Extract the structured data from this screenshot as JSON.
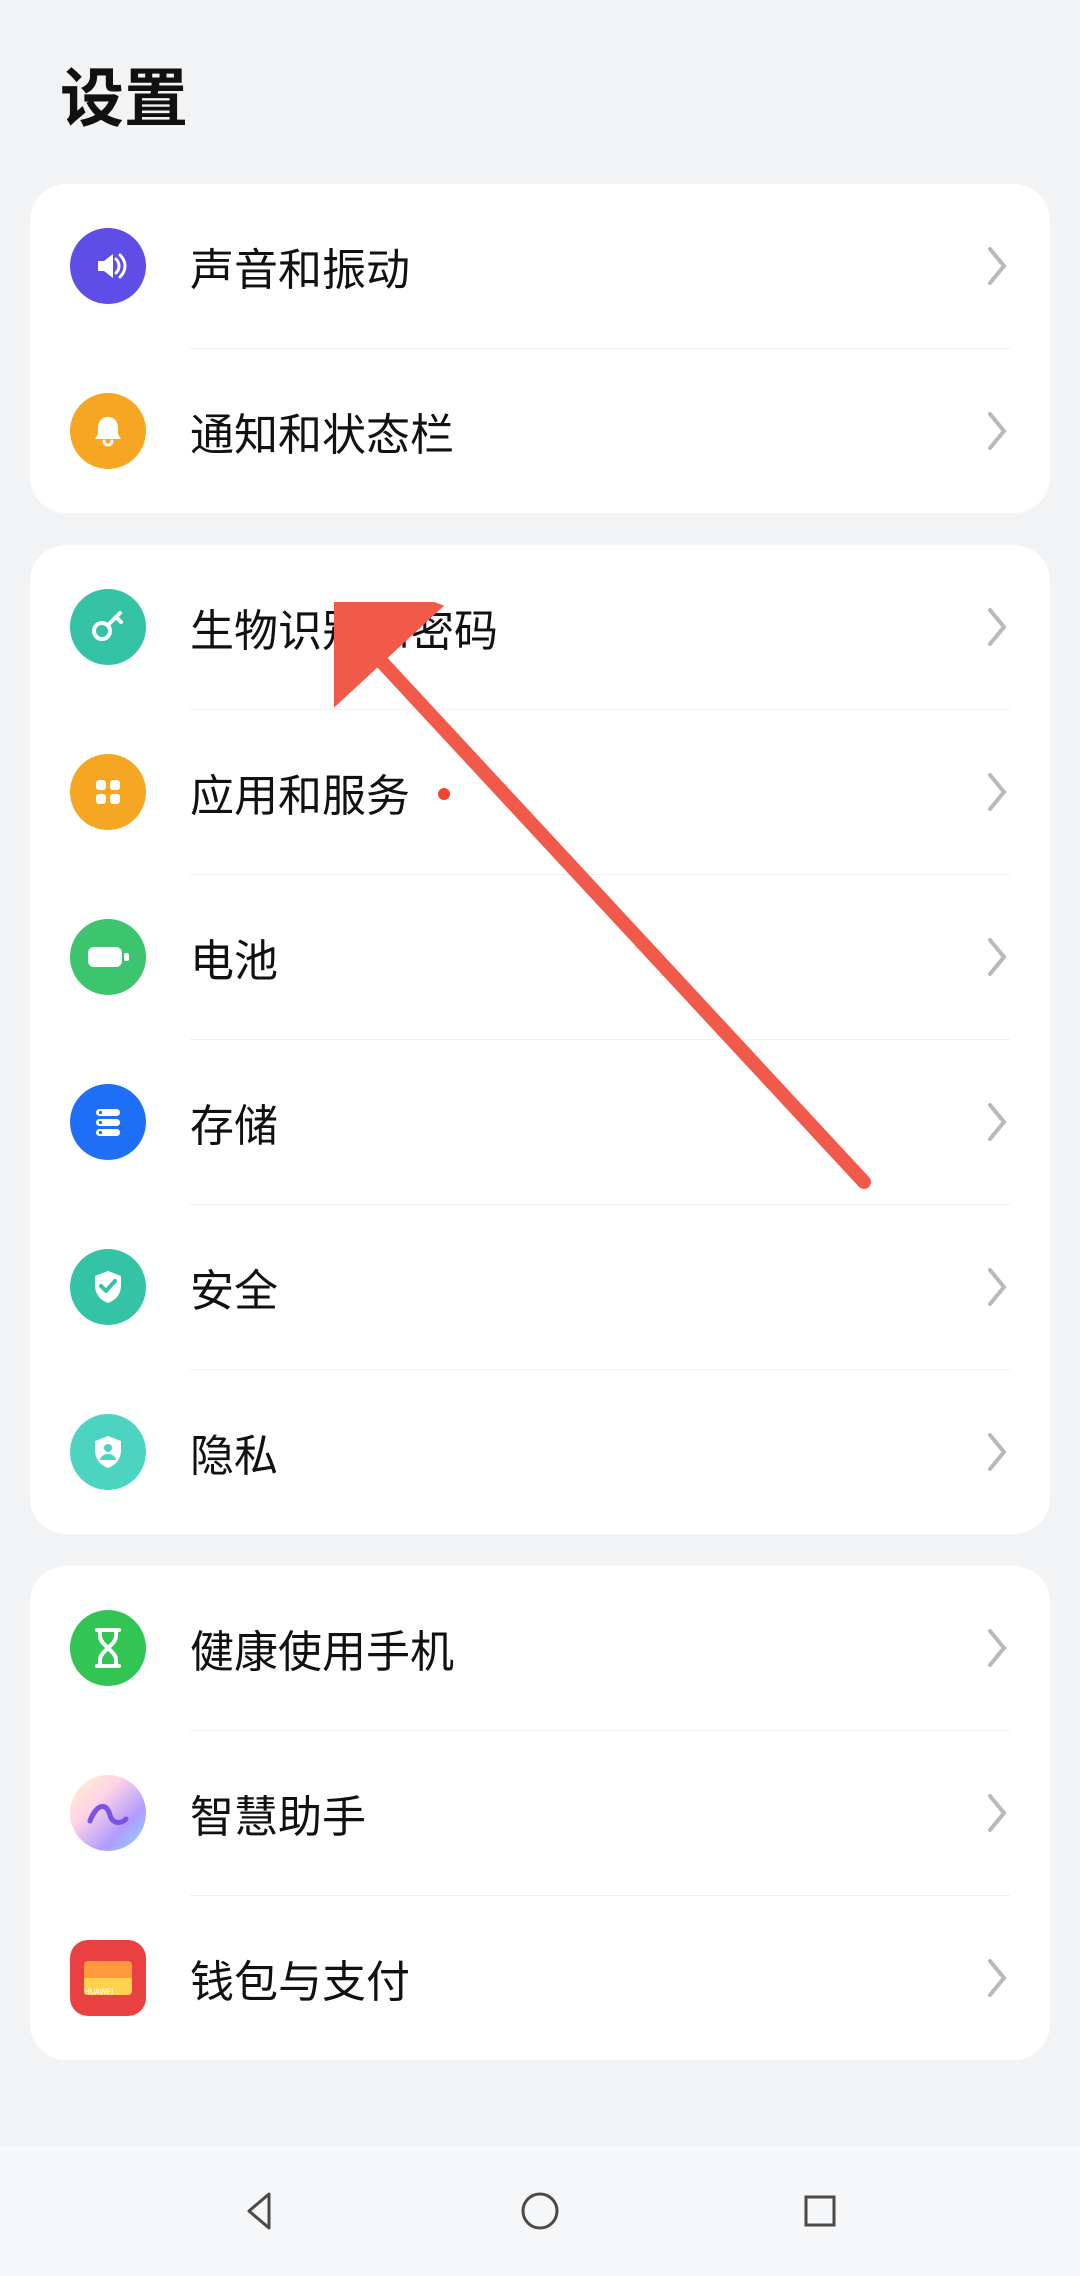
{
  "title": "设置",
  "groups": [
    {
      "items": [
        {
          "key": "sound",
          "label": "声音和振动"
        },
        {
          "key": "notify",
          "label": "通知和状态栏"
        }
      ]
    },
    {
      "items": [
        {
          "key": "biometrics",
          "label": "生物识别和密码"
        },
        {
          "key": "apps",
          "label": "应用和服务",
          "badge": true
        },
        {
          "key": "battery",
          "label": "电池"
        },
        {
          "key": "storage",
          "label": "存储"
        },
        {
          "key": "security",
          "label": "安全"
        },
        {
          "key": "privacy",
          "label": "隐私"
        }
      ]
    },
    {
      "items": [
        {
          "key": "digital",
          "label": "健康使用手机"
        },
        {
          "key": "assist",
          "label": "智慧助手"
        },
        {
          "key": "wallet",
          "label": "钱包与支付"
        }
      ]
    }
  ],
  "wallet_brand": "HUAWEI"
}
